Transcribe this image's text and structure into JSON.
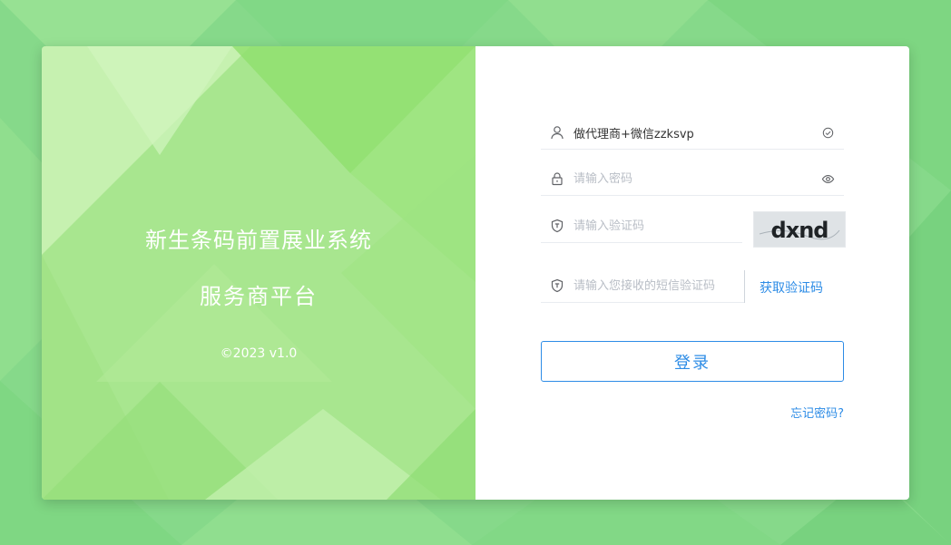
{
  "colors": {
    "page_bg": "#86d98a",
    "panel_bg": "#a8e68f",
    "accent": "#2d8ce6",
    "panel_text": "#ffffff"
  },
  "branding": {
    "system_title": "新生条码前置展业系统",
    "subtitle": "服务商平台",
    "copyright": "©2023 v1.0"
  },
  "form": {
    "username": {
      "icon": "user-icon",
      "value": "做代理商+微信zzksvp",
      "trailing_icon": "check-circle-icon"
    },
    "password": {
      "icon": "lock-icon",
      "placeholder": "请输入密码",
      "trailing_icon": "eye-icon"
    },
    "captcha": {
      "icon": "shield-icon",
      "placeholder": "请输入验证码",
      "image_text": "dxnd"
    },
    "sms_code": {
      "icon": "shield-icon",
      "placeholder": "请输入您接收的短信验证码",
      "get_code_label": "获取验证码"
    },
    "login_label": "登录",
    "forgot_label": "忘记密码?"
  }
}
